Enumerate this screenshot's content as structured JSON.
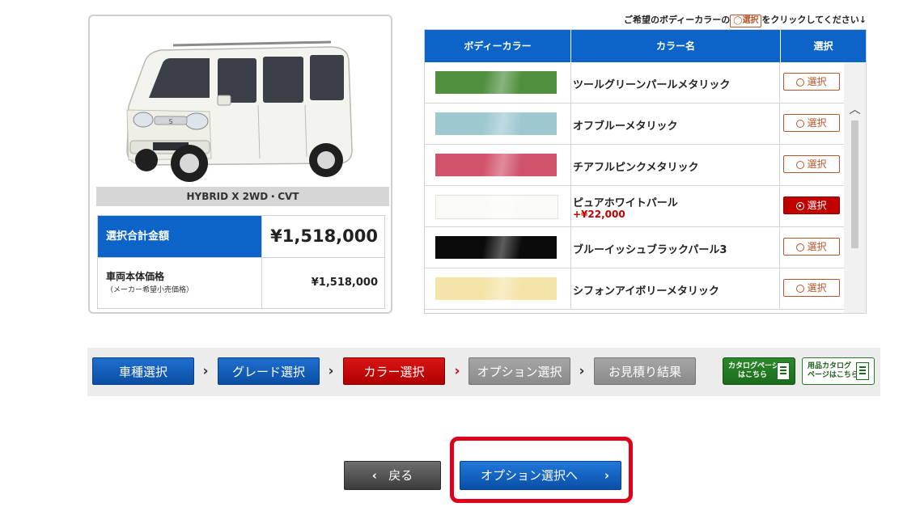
{
  "car": {
    "image_alt": "white compact minivan",
    "grade": "HYBRID X 2WD・CVT",
    "total_label": "選択合計金額",
    "total_value": "¥1,518,000",
    "base_label": "車両本体価格",
    "base_sublabel": "（メーカー希望小売価格）",
    "base_value": "¥1,518,000"
  },
  "instruction": {
    "prefix": "ご希望のボディーカラーの",
    "button": "選択",
    "suffix": "をクリックしてください↓"
  },
  "color_table": {
    "headers": [
      "ボディーカラー",
      "カラー名",
      "選択"
    ],
    "select_label": "選択",
    "rows": [
      {
        "name": "ツールグリーンパールメタリック",
        "extra": "",
        "selected": false,
        "color": "#4f8f3e"
      },
      {
        "name": "オフブルーメタリック",
        "extra": "",
        "selected": false,
        "color": "#9ec8d0"
      },
      {
        "name": "チアフルピンクメタリック",
        "extra": "",
        "selected": false,
        "color": "#d0536b"
      },
      {
        "name": "ピュアホワイトパール",
        "extra": "+¥22,000",
        "selected": true,
        "color": "#fbfbf6"
      },
      {
        "name": "ブルーイッシュブラックパール3",
        "extra": "",
        "selected": false,
        "color": "#0b0b0b"
      },
      {
        "name": "シフォンアイボリーメタリック",
        "extra": "",
        "selected": false,
        "color": "#f4e4a8"
      }
    ]
  },
  "steps": {
    "items": [
      {
        "label": "車種選択",
        "state": "blue"
      },
      {
        "label": "グレード選択",
        "state": "blue"
      },
      {
        "label": "カラー選択",
        "state": "red"
      },
      {
        "label": "オプション選択",
        "state": "gray"
      },
      {
        "label": "お見積り結果",
        "state": "gray"
      }
    ],
    "catalog1": [
      "カタログページ",
      "はこちら"
    ],
    "catalog2": [
      "用品カタログ",
      "ページはこちら"
    ]
  },
  "buttons": {
    "back": "戻る",
    "next": "オプション選択へ"
  }
}
